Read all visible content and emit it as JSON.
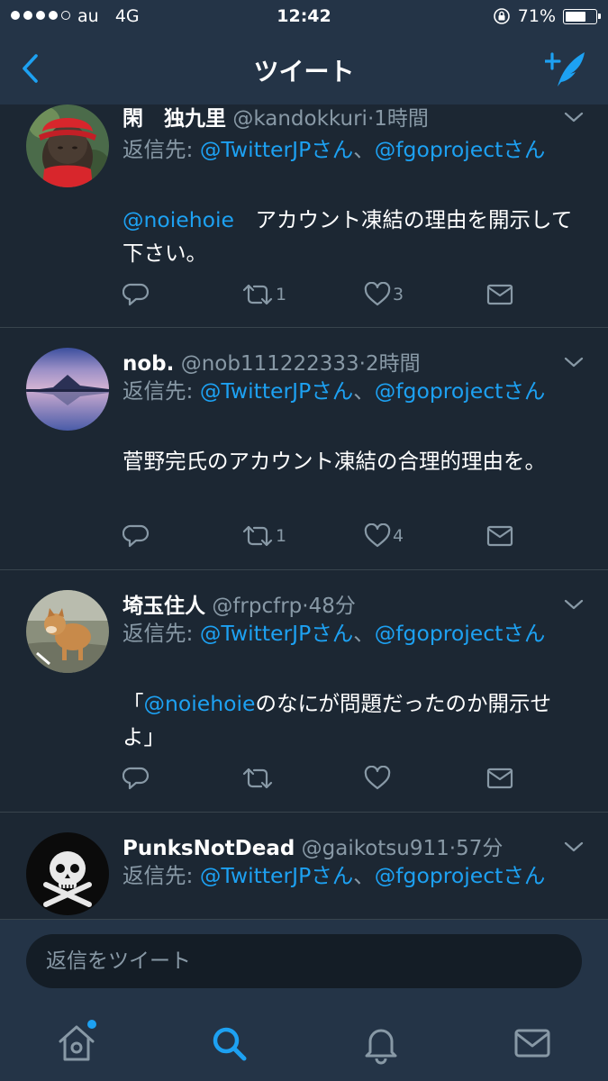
{
  "status_bar": {
    "carrier": "au",
    "network": "4G",
    "time": "12:42",
    "battery": "71%",
    "battery_level": 0.71
  },
  "nav": {
    "title": "ツイート"
  },
  "colors": {
    "background": "#1c2733",
    "bar": "#243447",
    "accent": "#1da1f2",
    "secondary_text": "#8899a6",
    "divider": "#38444d"
  },
  "tweets": [
    {
      "name": "閑　独九里",
      "handle": "@kandokkuri",
      "time": "1時間",
      "reply_prefix": "返信先: ",
      "reply_user1": "@TwitterJPさん",
      "reply_sep": "、",
      "reply_user2": "@fgoprojectさん",
      "mention": "@noiehoie",
      "text": "　アカウント凍結の理由を開示して下さい。",
      "retweets": "1",
      "likes": "3",
      "avatar_icon": "jizo-statue-avatar"
    },
    {
      "name": "nob.",
      "handle": "@nob111222333",
      "time": "2時間",
      "reply_prefix": "返信先: ",
      "reply_user1": "@TwitterJPさん",
      "reply_sep": "、",
      "reply_user2": "@fgoprojectさん",
      "text": "菅野完氏のアカウント凍結の合理的理由を。",
      "retweets": "1",
      "likes": "4",
      "avatar_icon": "mountain-lake-avatar"
    },
    {
      "name": "埼玉住人",
      "handle": "@frpcfrp",
      "time": "48分",
      "reply_prefix": "返信先: ",
      "reply_user1": "@TwitterJPさん",
      "reply_sep": "、",
      "reply_user2": "@fgoprojectさん",
      "quote_open": "「",
      "mention": "@noiehoie",
      "text": "のなにが問題だったのか開示せよ」",
      "avatar_icon": "shiba-dog-avatar"
    },
    {
      "name": "PunksNotDead",
      "handle": "@gaikotsu911",
      "time": "57分",
      "reply_prefix": "返信先: ",
      "reply_user1": "@TwitterJPさん",
      "reply_sep": "、",
      "reply_user2": "@fgoprojectさん",
      "avatar_icon": "skull-crossbones-avatar"
    }
  ],
  "meta_sep": "·",
  "reply_box": {
    "placeholder": "返信をツイート"
  },
  "tabs": [
    "home-icon",
    "search-icon",
    "notifications-icon",
    "messages-icon"
  ]
}
